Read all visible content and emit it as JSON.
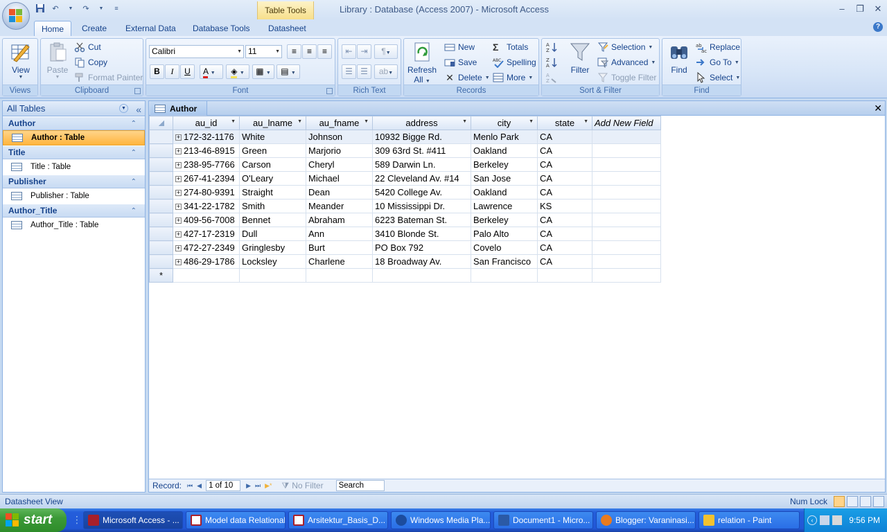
{
  "window": {
    "title": "Library : Database (Access 2007) - Microsoft Access",
    "contextual_tab_group": "Table Tools"
  },
  "ribbon_tabs": [
    "Home",
    "Create",
    "External Data",
    "Database Tools",
    "Datasheet"
  ],
  "ribbon": {
    "views": {
      "label": "Views",
      "view": "View"
    },
    "clipboard": {
      "label": "Clipboard",
      "paste": "Paste",
      "cut": "Cut",
      "copy": "Copy",
      "format_painter": "Format Painter"
    },
    "font": {
      "label": "Font",
      "font_name": "Calibri",
      "font_size": "11",
      "bold": "B",
      "italic": "I",
      "underline": "U",
      "font_color": "A"
    },
    "rich_text": {
      "label": "Rich Text"
    },
    "records": {
      "label": "Records",
      "refresh_all": "Refresh",
      "refresh_all_2": "All",
      "new": "New",
      "save": "Save",
      "delete": "Delete",
      "totals": "Totals",
      "spelling": "Spelling",
      "more": "More"
    },
    "sort_filter": {
      "label": "Sort & Filter",
      "filter": "Filter",
      "selection": "Selection",
      "advanced": "Advanced",
      "toggle_filter": "Toggle Filter"
    },
    "find": {
      "label": "Find",
      "find": "Find",
      "replace": "Replace",
      "goto": "Go To",
      "select": "Select"
    }
  },
  "nav_pane": {
    "header": "All Tables",
    "groups": [
      {
        "name": "Author",
        "item": "Author : Table"
      },
      {
        "name": "Title",
        "item": "Title : Table"
      },
      {
        "name": "Publisher",
        "item": "Publisher : Table"
      },
      {
        "name": "Author_Title",
        "item": "Author_Title : Table"
      }
    ]
  },
  "document_tab": "Author",
  "datasheet": {
    "columns": [
      "au_id",
      "au_lname",
      "au_fname",
      "address",
      "city",
      "state",
      "Add New Field"
    ],
    "rows": [
      [
        "172-32-1176",
        "White",
        "Johnson",
        "10932 Bigge Rd.",
        "Menlo Park",
        "CA"
      ],
      [
        "213-46-8915",
        "Green",
        "Marjorio",
        "309 63rd St. #411",
        "Oakland",
        "CA"
      ],
      [
        "238-95-7766",
        "Carson",
        "Cheryl",
        "589 Darwin Ln.",
        "Berkeley",
        "CA"
      ],
      [
        "267-41-2394",
        "O'Leary",
        "Michael",
        "22 Cleveland Av. #14",
        "San Jose",
        "CA"
      ],
      [
        "274-80-9391",
        "Straight",
        "Dean",
        "5420 College Av.",
        "Oakland",
        "CA"
      ],
      [
        "341-22-1782",
        "Smith",
        "Meander",
        "10 Mississippi Dr.",
        "Lawrence",
        "KS"
      ],
      [
        "409-56-7008",
        "Bennet",
        "Abraham",
        "6223 Bateman St.",
        "Berkeley",
        "CA"
      ],
      [
        "427-17-2319",
        "Dull",
        "Ann",
        "3410 Blonde St.",
        "Palo Alto",
        "CA"
      ],
      [
        "472-27-2349",
        "Gringlesby",
        "Burt",
        "PO Box 792",
        "Covelo",
        "CA"
      ],
      [
        "486-29-1786",
        "Locksley",
        "Charlene",
        "18 Broadway Av.",
        "San Francisco",
        "CA"
      ]
    ],
    "new_row_marker": "*"
  },
  "record_nav": {
    "label": "Record:",
    "position": "1 of 10",
    "no_filter": "No Filter",
    "search": "Search"
  },
  "status_bar": {
    "view": "Datasheet View",
    "num_lock": "Num Lock"
  },
  "taskbar": {
    "start": "start",
    "tasks": [
      "Microsoft Access - ...",
      "Model data Relational",
      "Arsitektur_Basis_D...",
      "Windows Media Pla...",
      "Document1 - Micro...",
      "Blogger: Varaninasi...",
      "relation - Paint"
    ],
    "clock": "9:56 PM"
  },
  "colors": {
    "accent_selected": "#ffb53d",
    "ribbon_text": "#15428b",
    "taskbar_blue": "#245edb",
    "start_green": "#3c9a38"
  }
}
